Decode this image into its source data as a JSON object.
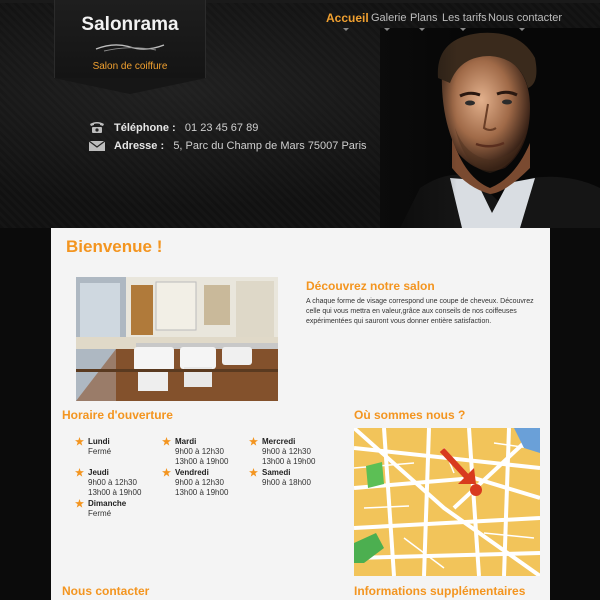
{
  "header": {
    "logo": {
      "title": "Salonrama",
      "subtitle": "Salon de coiffure"
    },
    "nav": [
      {
        "label": "Accueil",
        "active": true
      },
      {
        "label": "Galerie",
        "active": false
      },
      {
        "label": "Plans",
        "active": false
      },
      {
        "label": "Les tarifs",
        "active": false
      },
      {
        "label": "Nous contacter",
        "active": false
      }
    ],
    "contact": {
      "phone_label": "Téléphone :",
      "phone_value": "01 23 45 67 89",
      "address_label": "Adresse :",
      "address_value": "5, Parc du Champ de Mars 75007 Paris"
    }
  },
  "main": {
    "welcome_title": "Bienvenue !",
    "discover_title": "Découvrez notre salon",
    "discover_text": "A chaque forme de visage correspond une coupe de cheveux. Découvrez celle qui vous mettra en valeur,grâce aux conseils de nos coiffeuses expérimentées qui sauront vous donner entière satisfaction.",
    "hours_title": "Horaire d'ouverture",
    "hours": [
      {
        "day": "Lundi",
        "times": [
          "Fermé"
        ]
      },
      {
        "day": "Jeudi",
        "times": [
          "9h00 à 12h30",
          "13h00 à 19h00"
        ]
      },
      {
        "day": "Dimanche",
        "times": [
          "Fermé"
        ]
      },
      {
        "day": "Mardi",
        "times": [
          "9h00 à 12h30",
          "13h00 à 19h00"
        ]
      },
      {
        "day": "Vendredi",
        "times": [
          "9h00 à 12h30",
          "13h00 à 19h00"
        ]
      },
      {
        "day": "Mercredi",
        "times": [
          "9h00 à 12h30",
          "13h00 à 19h00"
        ]
      },
      {
        "day": "Samedi",
        "times": [
          "9h00 à 18h00"
        ]
      }
    ],
    "where_title": "Où sommes nous ?",
    "contact_title": "Nous contacter",
    "extra_title": "Informations supplémentaires"
  },
  "colors": {
    "accent": "#f39520",
    "background": "#0b0b0b",
    "panel": "#f4f4f4"
  },
  "icons": {
    "phone": "phone-icon",
    "address": "envelope-icon",
    "hours_bullet": "star-icon"
  }
}
